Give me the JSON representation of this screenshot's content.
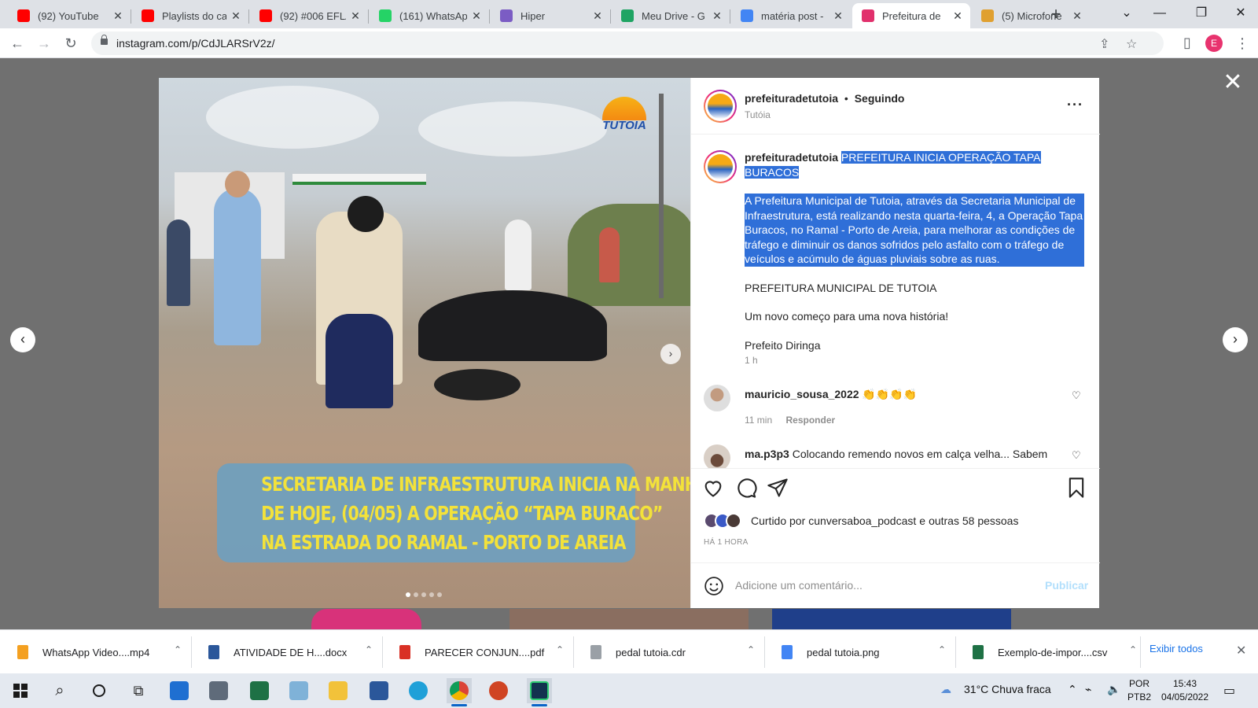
{
  "browser": {
    "tabs": [
      {
        "title": "(92) YouTube",
        "icon": "youtube-icon",
        "color": "#ff0000"
      },
      {
        "title": "Playlists do ca",
        "icon": "youtube-icon",
        "color": "#ff0000"
      },
      {
        "title": "(92) #006 EFLA",
        "icon": "youtube-icon",
        "color": "#ff0000"
      },
      {
        "title": "(161) WhatsAp",
        "icon": "whatsapp-icon",
        "color": "#25d366"
      },
      {
        "title": "Hiper",
        "icon": "hiper-icon",
        "color": "#7b5cc4"
      },
      {
        "title": "Meu Drive - G",
        "icon": "google-drive-icon",
        "color": "#1fa463"
      },
      {
        "title": "matéria post -",
        "icon": "google-docs-icon",
        "color": "#4285f4"
      },
      {
        "title": "Prefeitura de",
        "icon": "instagram-icon",
        "color": "#e1306c"
      },
      {
        "title": "(5) Microfone",
        "icon": "podcast-icon",
        "color": "#e0a030"
      }
    ],
    "url": "instagram.com/p/CdJLARSrV2z/",
    "profile_initial": "E"
  },
  "post": {
    "account": "prefeituradetutoia",
    "following": "Seguindo",
    "separator": "•",
    "location": "Tutóia",
    "image": {
      "logo_text": "TUTOIA",
      "banner_lines": [
        "SECRETARIA DE INFRAESTRUTURA INICIA NA MANHÃ",
        "DE HOJE, (04/05) A OPERAÇÃO “TAPA BURACO”",
        "NA ESTRADA DO RAMAL - PORTO DE AREIA"
      ]
    },
    "caption": {
      "headline": "PREFEITURA INICIA OPERAÇÃO TAPA BURACOS",
      "body": "A Prefeitura Municipal de Tutoia, através da Secretaria Municipal de Infraestrutura, está realizando nesta quarta-feira, 4, a Operação Tapa Buracos, no Ramal - Porto de Areia, para melhorar as condições de tráfego e diminuir os danos sofridos pelo asfalto com o tráfego de veículos e acúmulo de águas pluviais sobre as ruas.",
      "line2": "PREFEITURA MUNICIPAL DE TUTOIA",
      "line3": "Um novo começo para uma nova história!",
      "line4": "Prefeito Diringa",
      "time": "1 h"
    },
    "comments": [
      {
        "user": "mauricio_sousa_2022",
        "text": "👏👏👏👏",
        "time": "11 min",
        "reply": "Responder"
      },
      {
        "user": "ma.p3p3",
        "text": "Colocando remendo novos em calça velha... Sabem"
      }
    ],
    "likes": {
      "prefix": "Curtido por",
      "user": "cunversaboa_podcast",
      "connector": "e",
      "others": "outras 58 pessoas"
    },
    "posted_ago": "HÁ 1 HORA",
    "comment_placeholder": "Adicione um comentário...",
    "publish_label": "Publicar"
  },
  "downloads": [
    {
      "name": "WhatsApp Video....mp4",
      "color": "#f4a020"
    },
    {
      "name": "ATIVIDADE DE H....docx",
      "color": "#2b579a"
    },
    {
      "name": "PARECER CONJUN....pdf",
      "color": "#d93025"
    },
    {
      "name": "pedal tutoia.cdr",
      "color": "#9aa0a6"
    },
    {
      "name": "pedal tutoia.png",
      "color": "#4285f4"
    },
    {
      "name": "Exemplo-de-impor....csv",
      "color": "#1e7145"
    }
  ],
  "downloads_show_all": "Exibir todos",
  "taskbar": {
    "weather": "31°C  Chuva fraca",
    "lang1": "POR",
    "lang2": "PTB2",
    "time": "15:43",
    "date": "04/05/2022"
  }
}
